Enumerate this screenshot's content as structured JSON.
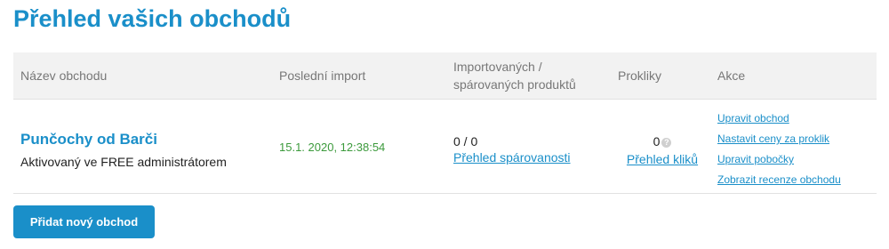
{
  "page": {
    "title": "Přehled vašich obchodů"
  },
  "table": {
    "headers": {
      "shop_name": "Název obchodu",
      "last_import": "Poslední import",
      "products_line1": "Importovaných /",
      "products_line2": "spárovaných produktů",
      "clicks": "Prokliky",
      "actions": "Akce"
    },
    "rows": [
      {
        "shop_name": "Punčochy od Barči",
        "shop_subtitle": "Aktivovaný ve FREE administrátorem",
        "last_import": "15.1. 2020, 12:38:54",
        "products_count": "0 / 0",
        "products_link": "Přehled spárovanosti",
        "clicks_count": "0",
        "clicks_help": "?",
        "clicks_link": "Přehled kliků",
        "actions": {
          "edit_shop": "Upravit obchod",
          "set_click_prices": "Nastavit ceny za proklik",
          "edit_branches": "Upravit pobočky",
          "show_reviews": "Zobrazit recenze obchodu"
        }
      }
    ]
  },
  "footer": {
    "add_shop_button": "Přidat nový obchod"
  },
  "colors": {
    "accent": "#1a8fc9",
    "date_green": "#3c9a3c",
    "header_bg": "#f2f2f2"
  }
}
